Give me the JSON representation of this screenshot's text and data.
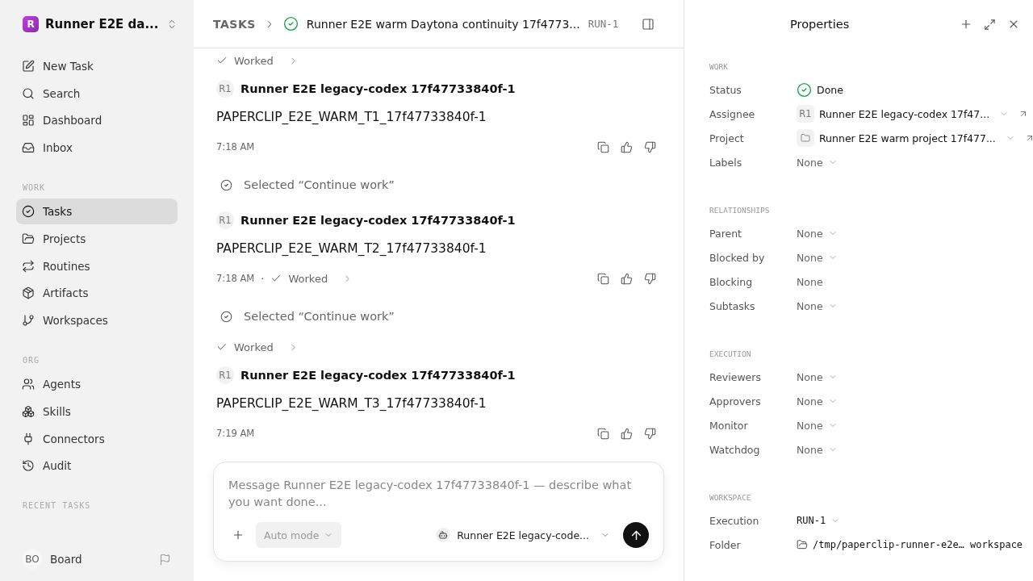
{
  "workspace": {
    "initial": "R",
    "name": "Runner E2E da..."
  },
  "nav_sections": [
    {
      "items": [
        {
          "label": "New Task",
          "selected": false
        },
        {
          "label": "Search",
          "selected": false
        },
        {
          "label": "Dashboard",
          "selected": false
        },
        {
          "label": "Inbox",
          "selected": false
        }
      ]
    },
    {
      "label": "WORK",
      "items": [
        {
          "label": "Tasks",
          "selected": true
        },
        {
          "label": "Projects",
          "selected": false
        },
        {
          "label": "Routines",
          "selected": false
        },
        {
          "label": "Artifacts",
          "selected": false
        },
        {
          "label": "Workspaces",
          "selected": false
        }
      ]
    },
    {
      "label": "ORG",
      "items": [
        {
          "label": "Agents",
          "selected": false
        },
        {
          "label": "Skills",
          "selected": false
        },
        {
          "label": "Connectors",
          "selected": false
        },
        {
          "label": "Audit",
          "selected": false
        }
      ]
    },
    {
      "label": "RECENT TASKS"
    }
  ],
  "board": {
    "initials": "BO",
    "label": "Board"
  },
  "header": {
    "breadcrumb": "TASKS",
    "title": "Runner E2E warm Daytona continuity 17f4773...",
    "run": "RUN-1"
  },
  "timeline": [
    {
      "kind": "worked",
      "label": "Worked"
    },
    {
      "kind": "message",
      "avatar": "R1",
      "author": "Runner E2E legacy-codex 17f47733840f-1",
      "body": "PAPERCLIP_E2E_WARM_T1_17f47733840f-1",
      "time": "7:18 AM"
    },
    {
      "kind": "selection",
      "text": "Selected “Continue work”"
    },
    {
      "kind": "message",
      "avatar": "R1",
      "author": "Runner E2E legacy-codex 17f47733840f-1",
      "body": "PAPERCLIP_E2E_WARM_T2_17f47733840f-1",
      "time": "7:18 AM",
      "separator": "·",
      "worked": "Worked"
    },
    {
      "kind": "selection",
      "text": "Selected “Continue work”"
    },
    {
      "kind": "worked",
      "label": "Worked"
    },
    {
      "kind": "message",
      "avatar": "R1",
      "author": "Runner E2E legacy-codex 17f47733840f-1",
      "body": "PAPERCLIP_E2E_WARM_T3_17f47733840f-1",
      "time": "7:19 AM"
    }
  ],
  "composer": {
    "placeholder": "Message Runner E2E legacy-codex 17f47733840f-1 — describe what you want done...",
    "mode": "Auto mode",
    "agent": "Runner E2E legacy-code..."
  },
  "properties": {
    "title": "Properties",
    "sections": [
      {
        "label": "WORK",
        "rows": [
          {
            "kind": "status",
            "label": "Status",
            "value": "Done"
          },
          {
            "kind": "agent",
            "label": "Assignee",
            "avatar": "R1",
            "value": "Runner E2E legacy-codex 17f47..."
          },
          {
            "kind": "project",
            "label": "Project",
            "value": "Runner E2E warm project 17f477..."
          },
          {
            "kind": "select",
            "label": "Labels",
            "value": "None"
          }
        ]
      },
      {
        "label": "RELATIONSHIPS",
        "rows": [
          {
            "kind": "select",
            "label": "Parent",
            "value": "None"
          },
          {
            "kind": "select",
            "label": "Blocked by",
            "value": "None"
          },
          {
            "kind": "plain",
            "label": "Blocking",
            "value": "None"
          },
          {
            "kind": "select",
            "label": "Subtasks",
            "value": "None"
          }
        ]
      },
      {
        "label": "EXECUTION",
        "rows": [
          {
            "kind": "select",
            "label": "Reviewers",
            "value": "None"
          },
          {
            "kind": "select",
            "label": "Approvers",
            "value": "None"
          },
          {
            "kind": "select",
            "label": "Monitor",
            "value": "None"
          },
          {
            "kind": "select",
            "label": "Watchdog",
            "value": "None"
          }
        ]
      },
      {
        "label": "WORKSPACE",
        "rows": [
          {
            "kind": "run",
            "label": "Execution",
            "value": "RUN-1"
          },
          {
            "kind": "folder",
            "label": "Folder",
            "value": "/tmp/paperclip-runner-e2e… workspace"
          }
        ]
      }
    ]
  }
}
